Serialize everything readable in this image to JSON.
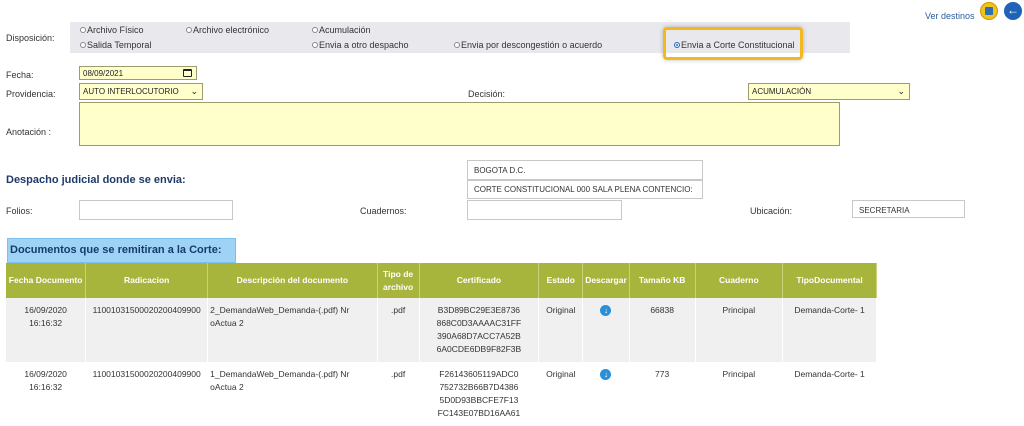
{
  "header": {
    "ver_destinos": "Ver destinos",
    "save_icon": "save-icon",
    "back_icon": "back-arrow-icon"
  },
  "disposicion": {
    "label": "Disposición:",
    "options": [
      {
        "label": "Archivo Físico",
        "selected": false
      },
      {
        "label": "Archivo electrónico",
        "selected": false
      },
      {
        "label": "Acumulación",
        "selected": false
      },
      {
        "label": "Salida Temporal",
        "selected": false
      },
      {
        "label": "Envia a otro despacho",
        "selected": false
      },
      {
        "label": "Envia por descongestión o acuerdo",
        "selected": false
      },
      {
        "label": "Envia a Corte Constitucional",
        "selected": true
      }
    ]
  },
  "form": {
    "fecha_label": "Fecha:",
    "fecha_value": "08/09/2021",
    "providencia_label": "Providencia:",
    "providencia_value": "AUTO INTERLOCUTORIO",
    "decision_label": "Decisión:",
    "decision_value": "ACUMULACIÓN",
    "anotacion_label": "Anotación :",
    "anotacion_value": ""
  },
  "despacho": {
    "title": "Despacho judicial donde se envia:",
    "ciudad": "BOGOTA D.C.",
    "despacho": "CORTE CONSTITUCIONAL 000 SALA PLENA CONTENCIO:",
    "folios_label": "Folios:",
    "folios_value": "",
    "cuadernos_label": "Cuadernos:",
    "cuadernos_value": "",
    "ubicacion_label": "Ubicación:",
    "ubicacion_value": "SECRETARIA"
  },
  "documentos": {
    "title": "Documentos que se remitiran a la Corte:",
    "columns": [
      "Fecha Documento",
      "Radicacion",
      "Descripción del documento",
      "Tipo de archivo",
      "Certificado",
      "Estado",
      "Descargar",
      "Tamaño KB",
      "Cuaderno",
      "TipoDocumental"
    ],
    "rows": [
      {
        "fecha": "16/09/2020 16:16:32",
        "radicacion": "11001031500020200409900",
        "descripcion": "2_DemandaWeb_Demanda-(.pdf) Nr oActua 2",
        "tipo": ".pdf",
        "certificado": "B3D89BC29E3E8736 868C0D3AAAAC31FF 390A68D7ACC7A52B 6A0CDE6DB9F82F3B",
        "estado": "Original",
        "tamano": "66838",
        "cuaderno": "Principal",
        "tipodoc": "Demanda-Corte- 1"
      },
      {
        "fecha": "16/09/2020 16:16:32",
        "radicacion": "11001031500020200409900",
        "descripcion": "1_DemandaWeb_Demanda-(.pdf) Nr oActua 2",
        "tipo": ".pdf",
        "certificado": "F26143605119ADC0 752732B66B7D4386 5D0D93BBCFE7F13 FC143E07BD16AA61",
        "estado": "Original",
        "tamano": "773",
        "cuaderno": "Principal",
        "tipodoc": "Demanda-Corte- 1"
      }
    ]
  }
}
